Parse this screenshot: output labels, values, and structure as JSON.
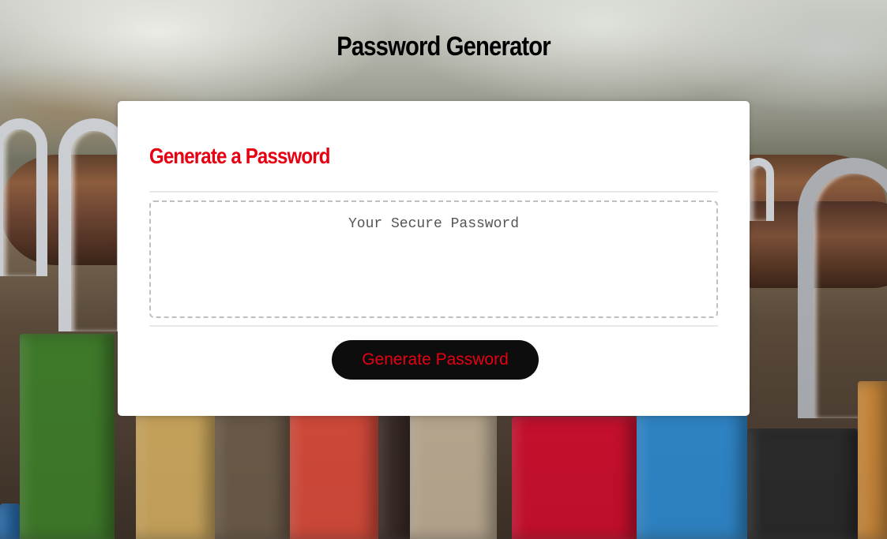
{
  "app": {
    "title": "Password Generator"
  },
  "card": {
    "header": "Generate a Password",
    "password_field": {
      "placeholder": "Your Secure Password",
      "value": ""
    },
    "generate_button_label": "Generate Password"
  },
  "colors": {
    "accent_red": "#e60012",
    "button_bg": "#0d0d0d",
    "card_bg": "#ffffff",
    "divider": "#e6e8ea"
  }
}
